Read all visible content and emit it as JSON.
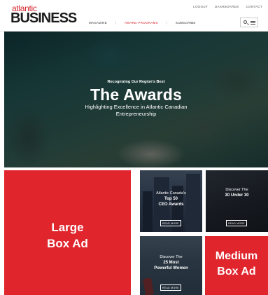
{
  "header": {
    "logo": {
      "top": "atlantic",
      "bottom": "BUSINESS"
    },
    "utility_nav": [
      "LOGOUT",
      "DASHBOARDS",
      "CONTACT"
    ],
    "main_nav": [
      {
        "label": "MAGAZINE",
        "active": false
      },
      {
        "label": "AWARD PROGRAMS",
        "active": true
      },
      {
        "label": "SUBSCRIBE",
        "active": false
      }
    ],
    "icons": [
      "search-icon",
      "menu-icon"
    ],
    "accent_color": "#d9232d"
  },
  "hero": {
    "kicker": "Recognizing Our Region's Best",
    "title": "The Awards",
    "subtitle_line1": "Highlighting Excellence in Atlantic Canadian",
    "subtitle_line2": "Entrepreneurship"
  },
  "ads": {
    "large": {
      "line1": "Large",
      "line2": "Box Ad",
      "color": "#e0252d"
    },
    "medium": {
      "line1": "Medium",
      "line2": "Box Ad",
      "color": "#e0252d"
    }
  },
  "tiles": [
    {
      "kicker": "Atlantic Canada's",
      "title_line1": "Top 50",
      "title_line2": "CEO Awards",
      "button": "READ MORE"
    },
    {
      "kicker": "Discover The",
      "title_line1": "30 Under 30",
      "button": "READ MORE"
    },
    {
      "kicker": "Discover The",
      "title_line1": "25 Most",
      "title_line2": "Powerful Women",
      "button": "READ MORE"
    }
  ]
}
